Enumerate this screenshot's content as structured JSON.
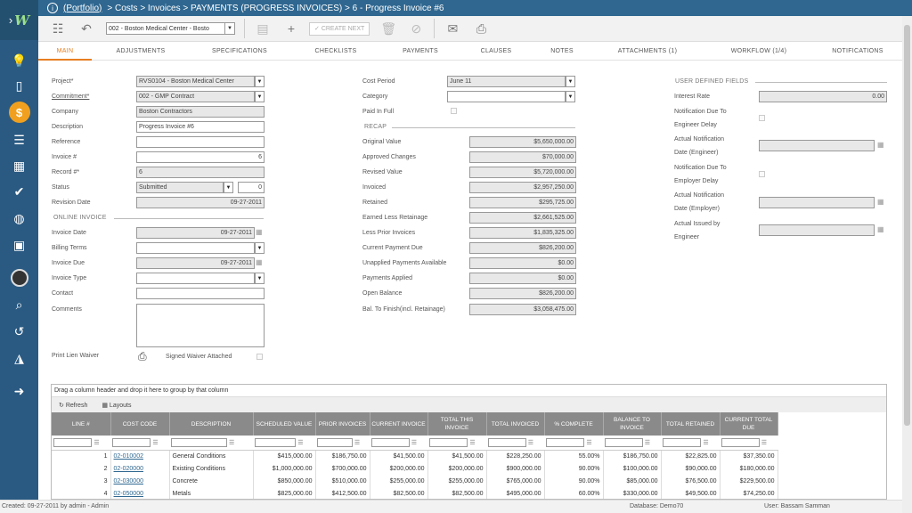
{
  "app": {
    "logo": "W"
  },
  "breadcrumb": {
    "portfolio": "(Portfolio)",
    "path": "> Costs > Invoices > PAYMENTS (PROGRESS INVOICES) > 6 - Progress Invoice #6"
  },
  "toolbar": {
    "project_select": "002 - Boston Medical Center - Bosto",
    "create_next": "CREATE NEXT"
  },
  "tabs": [
    "MAIN",
    "ADJUSTMENTS",
    "SPECIFICATIONS",
    "CHECKLISTS",
    "PAYMENTS",
    "CLAUSES",
    "NOTES",
    "ATTACHMENTS (1)",
    "WORKFLOW (1/4)",
    "NOTIFICATIONS"
  ],
  "left": {
    "project_label": "Project*",
    "project": "RVS0104 - Boston Medical Center",
    "commitment_label": "Commitment*",
    "commitment": "002 - GMP Contract",
    "company_label": "Company",
    "company": "Boston Contractors",
    "description_label": "Description",
    "description": "Progress Invoice #6",
    "reference_label": "Reference",
    "reference": "",
    "invoice_no_label": "Invoice #",
    "invoice_no": "6",
    "record_label": "Record #*",
    "record": "6",
    "status_label": "Status",
    "status": "Submitted",
    "status_num": "0",
    "revision_date_label": "Revision Date",
    "revision_date": "09-27-2011",
    "online_invoice_section": "ONLINE INVOICE",
    "invoice_date_label": "Invoice Date",
    "invoice_date": "09-27-2011",
    "billing_terms_label": "Billing Terms",
    "billing_terms": "",
    "invoice_due_label": "Invoice Due",
    "invoice_due": "09-27-2011",
    "invoice_type_label": "Invoice Type",
    "invoice_type": "",
    "contact_label": "Contact",
    "contact": "",
    "comments_label": "Comments",
    "comments": "",
    "print_lien_label": "Print Lien Waiver",
    "signed_waiver_label": "Signed Waiver Attached"
  },
  "middle": {
    "cost_period_label": "Cost Period",
    "cost_period": "June 11",
    "category_label": "Category",
    "category": "",
    "paid_in_full_label": "Paid In Full",
    "recap_section": "RECAP",
    "recap": [
      {
        "label": "Original Value",
        "value": "$5,650,000.00"
      },
      {
        "label": "Approved Changes",
        "value": "$70,000.00"
      },
      {
        "label": "Revised Value",
        "value": "$5,720,000.00"
      },
      {
        "label": "Invoiced",
        "value": "$2,957,250.00"
      },
      {
        "label": "Retained",
        "value": "$295,725.00"
      },
      {
        "label": "Earned Less Retainage",
        "value": "$2,661,525.00"
      },
      {
        "label": "Less Prior Invoices",
        "value": "$1,835,325.00"
      },
      {
        "label": "Current Payment Due",
        "value": "$826,200.00"
      },
      {
        "label": "Unapplied Payments Available",
        "value": "$0.00"
      },
      {
        "label": "Payments Applied",
        "value": "$0.00"
      },
      {
        "label": "Open Balance",
        "value": "$826,200.00"
      },
      {
        "label": "Bal. To Finish(incl. Retainage)",
        "value": "$3,058,475.00"
      }
    ]
  },
  "right": {
    "section": "USER DEFINED FIELDS",
    "interest_rate_label": "Interest Rate",
    "interest_rate": "0.00",
    "notif_engineer_label1": "Notification Due To",
    "notif_engineer_label2": "Engineer Delay",
    "actual_notif_engineer_label1": "Actual Notification",
    "actual_notif_engineer_label2": "Date (Engineer)",
    "notif_employer_label1": "Notification Due To",
    "notif_employer_label2": "Employer Delay",
    "actual_notif_employer_label1": "Actual Notification",
    "actual_notif_employer_label2": "Date (Employer)",
    "actual_issued_label1": "Actual Issued by",
    "actual_issued_label2": "Engineer"
  },
  "grid": {
    "group_hint": "Drag a column header and drop it here to group by that column",
    "refresh": "Refresh",
    "layouts": "Layouts",
    "columns": [
      "LINE #",
      "COST CODE",
      "DESCRIPTION",
      "SCHEDULED VALUE",
      "PRIOR INVOICES",
      "CURRENT INVOICE",
      "TOTAL THIS INVOICE",
      "TOTAL INVOICED",
      "% COMPLETE",
      "BALANCE TO INVOICE",
      "TOTAL RETAINED",
      "CURRENT TOTAL DUE"
    ],
    "rows": [
      [
        "1",
        "02-010002",
        "General Conditions",
        "$415,000.00",
        "$186,750.00",
        "$41,500.00",
        "$41,500.00",
        "$228,250.00",
        "55.00%",
        "$186,750.00",
        "$22,825.00",
        "$37,350.00"
      ],
      [
        "2",
        "02-020000",
        "Existing Conditions",
        "$1,000,000.00",
        "$700,000.00",
        "$200,000.00",
        "$200,000.00",
        "$900,000.00",
        "90.00%",
        "$100,000.00",
        "$90,000.00",
        "$180,000.00"
      ],
      [
        "3",
        "02-030000",
        "Concrete",
        "$850,000.00",
        "$510,000.00",
        "$255,000.00",
        "$255,000.00",
        "$765,000.00",
        "90.00%",
        "$85,000.00",
        "$76,500.00",
        "$229,500.00"
      ],
      [
        "4",
        "02-050000",
        "Metals",
        "$825,000.00",
        "$412,500.00",
        "$82,500.00",
        "$82,500.00",
        "$495,000.00",
        "60.00%",
        "$330,000.00",
        "$49,500.00",
        "$74,250.00"
      ]
    ]
  },
  "status": {
    "created": "Created:  09-27-2011 by admin - Admin",
    "database": "Database:   Demo70",
    "user": "User:   Bassam Samman"
  }
}
